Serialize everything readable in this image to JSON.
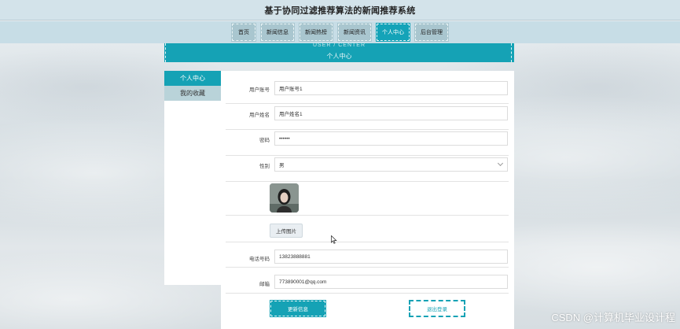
{
  "header": {
    "title": "基于协同过滤推荐算法的新闻推荐系统"
  },
  "nav": {
    "items": [
      "首页",
      "新闻信息",
      "新闻热榜",
      "新闻资讯",
      "个人中心",
      "后台管理"
    ],
    "active_index": 4
  },
  "banner": {
    "en": "USER / CENTER",
    "cn": "个人中心"
  },
  "sidebar": {
    "items": [
      "个人中心",
      "我的收藏"
    ],
    "active_index": 0
  },
  "form": {
    "account": {
      "label": "用户账号",
      "value": "用户账号1"
    },
    "name": {
      "label": "用户姓名",
      "value": "用户姓名1"
    },
    "password": {
      "label": "密码",
      "value": "••••••"
    },
    "gender": {
      "label": "性别",
      "value": "男"
    },
    "upload_label": "上传图片",
    "phone": {
      "label": "电话号码",
      "value": "13823888881"
    },
    "email": {
      "label": "邮箱",
      "value": "773890001@qq.com"
    },
    "update_label": "更新信息",
    "logout_label": "退出登录"
  },
  "watermark": "CSDN @计算机毕业设计程",
  "colors": {
    "accent": "#15a2b5",
    "nav_bg": "#a9c6cf",
    "header_bg": "#d3e3ea"
  }
}
